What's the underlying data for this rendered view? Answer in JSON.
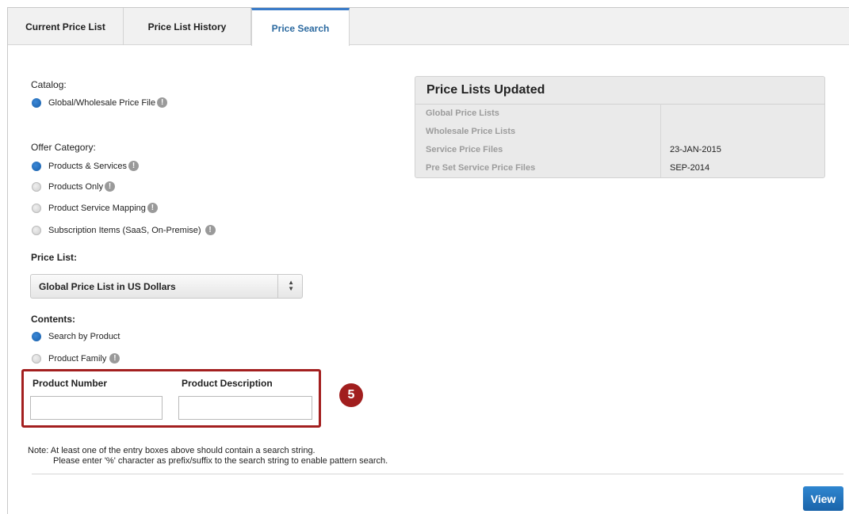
{
  "tabs": [
    {
      "label": "Current Price List"
    },
    {
      "label": "Price List History"
    },
    {
      "label": "Price Search",
      "active": true
    }
  ],
  "catalog": {
    "label": "Catalog:",
    "options": [
      {
        "label": "Global/Wholesale Price File",
        "selected": true
      }
    ]
  },
  "offer_category": {
    "label": "Offer Category:",
    "options": [
      {
        "label": "Products & Services",
        "selected": true
      },
      {
        "label": "Products Only",
        "selected": false
      },
      {
        "label": "Product Service Mapping",
        "selected": false
      },
      {
        "label": "Subscription Items (SaaS, On-Premise)",
        "selected": false
      }
    ]
  },
  "price_list": {
    "label": "Price List:",
    "selected": "Global Price List in US Dollars"
  },
  "contents": {
    "label": "Contents:",
    "options": [
      {
        "label": "Search by Product",
        "selected": true
      },
      {
        "label": "Product Family",
        "selected": false
      }
    ]
  },
  "search_fields": {
    "product_number_label": "Product Number",
    "product_number_value": "",
    "product_description_label": "Product Description",
    "product_description_value": ""
  },
  "step_badge": "5",
  "note": {
    "line1": "Note: At least one of the entry boxes above should contain a search string.",
    "line2": "Please enter '%' character as prefix/suffix to the search string to enable pattern search."
  },
  "view_button": "View",
  "panel": {
    "title": "Price Lists Updated",
    "rows": [
      {
        "key": "Global Price Lists",
        "value": ""
      },
      {
        "key": "Wholesale Price Lists",
        "value": ""
      },
      {
        "key": "Service Price Files",
        "value": "23-JAN-2015"
      },
      {
        "key": "Pre Set Service Price Files",
        "value": "SEP-2014"
      }
    ]
  },
  "info_glyph": "!",
  "colors": {
    "accent": "#1a64aa",
    "highlight": "#a31f1f",
    "active_tab_text": "#2c6aa0"
  }
}
